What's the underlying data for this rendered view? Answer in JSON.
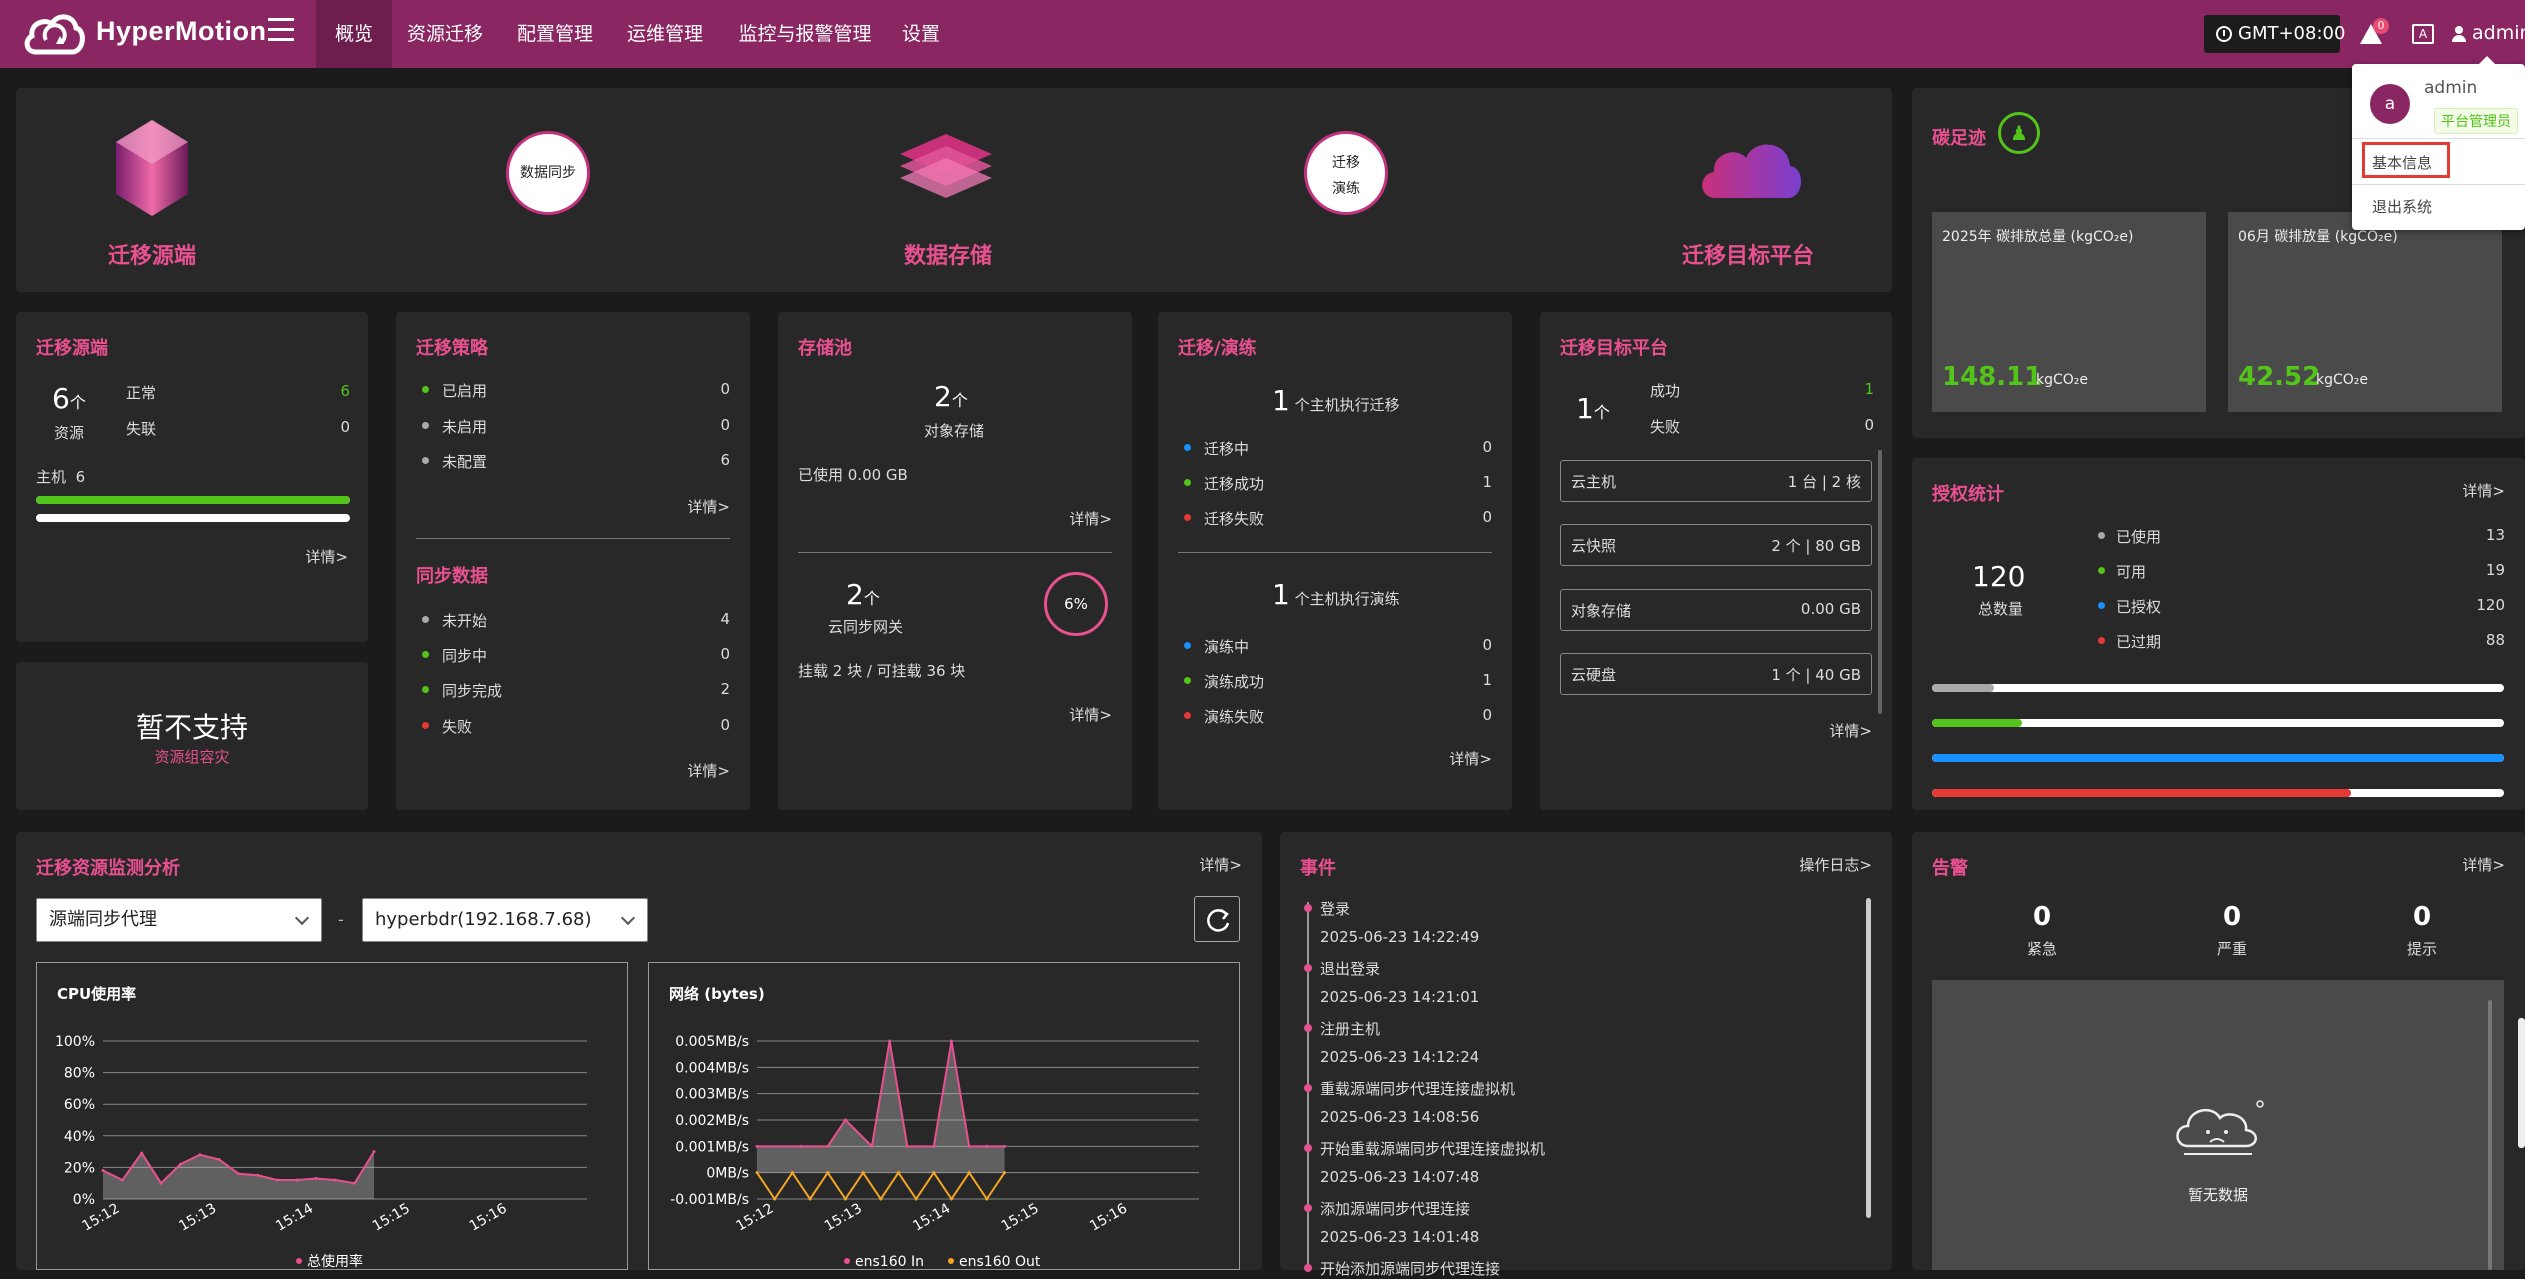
{
  "app": {
    "name": "HyperMotion"
  },
  "nav": [
    "概览",
    "资源迁移",
    "配置管理",
    "运维管理",
    "监控与报警管理",
    "设置"
  ],
  "header": {
    "timezone": "GMT+08:00",
    "alert_count": "0",
    "lang_icon": "A",
    "user": "admin"
  },
  "user_menu": {
    "avatar_letter": "a",
    "name": "admin",
    "role": "平台管理员",
    "items": [
      "基本信息",
      "退出系统"
    ]
  },
  "flow": {
    "source": "迁移源端",
    "sync": "数据同步",
    "storage": "数据存储",
    "drill_line1": "迁移",
    "drill_line2": "演练",
    "target": "迁移目标平台"
  },
  "source_panel": {
    "title": "迁移源端",
    "count": "6",
    "unit": "个",
    "count_label": "资源",
    "normal_label": "正常",
    "normal": "6",
    "lost_label": "失联",
    "lost": "0",
    "host_label": "主机",
    "host_count": "6",
    "detail": "详情>"
  },
  "unsupported": {
    "title": "暂不支持",
    "subtitle": "资源组容灾"
  },
  "strategy": {
    "title": "迁移策略",
    "items": [
      {
        "label": "已启用",
        "value": "0"
      },
      {
        "label": "未启用",
        "value": "0"
      },
      {
        "label": "未配置",
        "value": "6"
      }
    ],
    "detail": "详情>"
  },
  "sync_data": {
    "title": "同步数据",
    "items": [
      {
        "label": "未开始",
        "value": "4"
      },
      {
        "label": "同步中",
        "value": "0"
      },
      {
        "label": "同步完成",
        "value": "2"
      },
      {
        "label": "失败",
        "value": "0"
      }
    ],
    "detail": "详情>"
  },
  "storage_pool": {
    "title": "存储池",
    "obj_count": "2",
    "unit": "个",
    "obj_label": "对象存储",
    "used": "已使用 0.00 GB",
    "detail1": "详情>",
    "gw_count": "2",
    "gw_label": "云同步网关",
    "percent": "6%",
    "percent_value": 6,
    "mount": "挂载 2 块 / 可挂载 36 块",
    "detail2": "详情>"
  },
  "migration": {
    "title": "迁移/演练",
    "mig_count": "1",
    "mig_label": "个主机执行迁移",
    "mig_items": [
      {
        "label": "迁移中",
        "value": "0"
      },
      {
        "label": "迁移成功",
        "value": "1"
      },
      {
        "label": "迁移失败",
        "value": "0"
      }
    ],
    "drill_count": "1",
    "drill_label": "个主机执行演练",
    "drill_items": [
      {
        "label": "演练中",
        "value": "0"
      },
      {
        "label": "演练成功",
        "value": "1"
      },
      {
        "label": "演练失败",
        "value": "0"
      }
    ],
    "detail": "详情>"
  },
  "target": {
    "title": "迁移目标平台",
    "count": "1",
    "unit": "个",
    "success_label": "成功",
    "success": "1",
    "fail_label": "失败",
    "fail": "0",
    "rows": [
      {
        "label": "云主机",
        "value": "1 台 | 2 核"
      },
      {
        "label": "云快照",
        "value": "2 个 | 80 GB"
      },
      {
        "label": "对象存储",
        "value": "0.00 GB"
      },
      {
        "label": "云硬盘",
        "value": "1 个 | 40 GB"
      }
    ],
    "detail": "详情>"
  },
  "carbon": {
    "title": "碳足迹",
    "cards": [
      {
        "label": "2025年 碳排放总量 (kgCO₂e)",
        "value": "148.11",
        "unit": "kgCO₂e"
      },
      {
        "label": "06月 碳排放量 (kgCO₂e)",
        "value": "42.52",
        "unit": "kgCO₂e"
      }
    ]
  },
  "license": {
    "title": "授权统计",
    "detail": "详情>",
    "total": "120",
    "total_label": "总数量",
    "items": [
      {
        "label": "已使用",
        "value": "13",
        "color": "#aaaaaa",
        "fraction": 0.108
      },
      {
        "label": "可用",
        "value": "19",
        "color": "#52c41a",
        "fraction": 0.158
      },
      {
        "label": "已授权",
        "value": "120",
        "color": "#1890ff",
        "fraction": 1.0
      },
      {
        "label": "已过期",
        "value": "88",
        "color": "#e53935",
        "fraction": 0.733
      }
    ]
  },
  "monitor": {
    "title": "迁移资源监测分析",
    "detail": "详情>",
    "select1": "源端同步代理",
    "sep": "-",
    "select2": "hyperbdr(192.168.7.68)"
  },
  "chart_data": [
    {
      "type": "line",
      "title": "CPU使用率",
      "xlabel": "",
      "ylabel": "",
      "y_ticks": [
        "100%",
        "80%",
        "60%",
        "40%",
        "20%",
        "0%"
      ],
      "ylim": [
        0,
        100
      ],
      "x_ticks": [
        "15:12",
        "15:13",
        "15:14",
        "15:15",
        "15:16"
      ],
      "series": [
        {
          "name": "总使用率",
          "color": "#e8508f",
          "x": [
            0,
            0.2,
            0.4,
            0.6,
            0.8,
            1.0,
            1.2,
            1.4,
            1.6,
            1.8,
            2.0,
            2.2,
            2.4,
            2.6,
            2.8
          ],
          "values": [
            18,
            12,
            29,
            10,
            22,
            28,
            25,
            16,
            15,
            12,
            12,
            13,
            12,
            10,
            30
          ]
        }
      ],
      "grid": true,
      "legend": "bottom"
    },
    {
      "type": "line",
      "title": "网络 (bytes)",
      "xlabel": "",
      "ylabel": "",
      "y_ticks": [
        "0.005MB/s",
        "0.004MB/s",
        "0.003MB/s",
        "0.002MB/s",
        "0.001MB/s",
        "0MB/s",
        "-0.001MB/s"
      ],
      "ylim": [
        -0.001,
        0.005
      ],
      "x_ticks": [
        "15:12",
        "15:13",
        "15:14",
        "15:15",
        "15:16"
      ],
      "series": [
        {
          "name": "ens160 In",
          "color": "#e8508f",
          "x": [
            0,
            0.5,
            0.8,
            1.0,
            1.3,
            1.5,
            1.7,
            2.0,
            2.2,
            2.4,
            2.6,
            2.8
          ],
          "values": [
            0.001,
            0.001,
            0.001,
            0.002,
            0.001,
            0.005,
            0.001,
            0.001,
            0.005,
            0.001,
            0.001,
            0.001
          ]
        },
        {
          "name": "ens160 Out",
          "color": "#f5a623",
          "x": [
            0,
            0.2,
            0.4,
            0.6,
            0.8,
            1.0,
            1.2,
            1.4,
            1.6,
            1.8,
            2.0,
            2.2,
            2.4,
            2.6,
            2.8
          ],
          "values": [
            0,
            -0.001,
            0,
            -0.001,
            0,
            -0.001,
            0,
            -0.001,
            0,
            -0.001,
            0,
            -0.001,
            0,
            -0.001,
            0
          ]
        }
      ],
      "grid": true,
      "legend": "bottom"
    }
  ],
  "events": {
    "title": "事件",
    "log_link": "操作日志>",
    "items": [
      {
        "title": "登录",
        "time": "2025-06-23 14:22:49"
      },
      {
        "title": "退出登录",
        "time": "2025-06-23 14:21:01"
      },
      {
        "title": "注册主机",
        "time": "2025-06-23 14:12:24"
      },
      {
        "title": "重载源端同步代理连接虚拟机",
        "time": "2025-06-23 14:08:56"
      },
      {
        "title": "开始重载源端同步代理连接虚拟机",
        "time": "2025-06-23 14:07:48"
      },
      {
        "title": "添加源端同步代理连接",
        "time": "2025-06-23 14:01:48"
      },
      {
        "title": "开始添加源端同步代理连接",
        "time": ""
      }
    ]
  },
  "alarms": {
    "title": "告警",
    "detail": "详情>",
    "levels": [
      {
        "value": "0",
        "label": "紧急"
      },
      {
        "value": "0",
        "label": "严重"
      },
      {
        "value": "0",
        "label": "提示"
      }
    ],
    "empty": "暂无数据"
  }
}
